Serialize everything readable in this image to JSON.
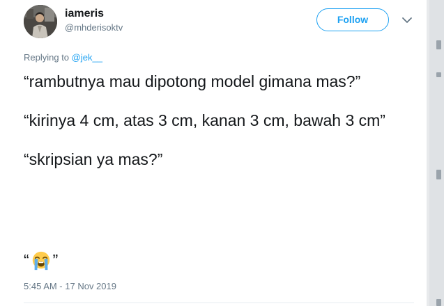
{
  "author": {
    "display_name": "iameris",
    "handle": "@mhderisoktv"
  },
  "follow_label": "Follow",
  "reply": {
    "prefix": "Replying to ",
    "mention": "@jek__"
  },
  "tweet": {
    "lines": [
      "“rambutnya mau dipotong model gimana mas?”",
      "“kirinya 4 cm, atas 3 cm, kanan 3 cm, bawah 3 cm”",
      "“skripsian ya mas?”"
    ],
    "emoji_open_quote": "“",
    "emoji_close_quote": "”",
    "emoji_name": "loudly-crying-face-icon"
  },
  "timestamp": "5:45 AM - 17 Nov 2019",
  "colors": {
    "accent": "#1da1f2",
    "secondary_text": "#657786",
    "primary_text": "#14171a"
  }
}
